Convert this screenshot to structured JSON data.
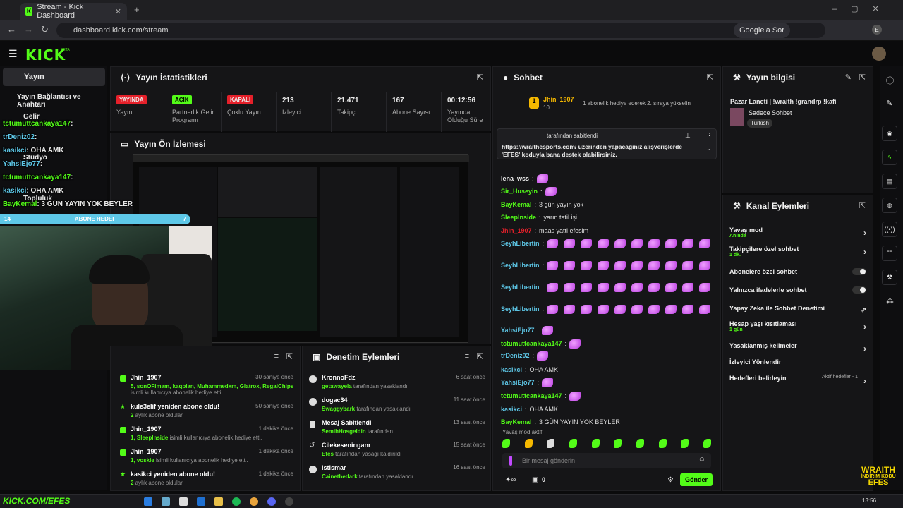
{
  "browser": {
    "tab_title": "Stream - Kick Dashboard",
    "url": "dashboard.kick.com/stream",
    "google_btn": "Google'a Sor",
    "profile_initial": "E"
  },
  "app": {
    "logo": "KICK",
    "beta": "BETA"
  },
  "sidebar": {
    "items": [
      {
        "label": "Yayın"
      },
      {
        "label": "Yayın Bağlantısı ve Anahtarı"
      },
      {
        "label": "Gelir"
      },
      {
        "label": "Stüdyo"
      },
      {
        "label": "Topluluk"
      }
    ]
  },
  "overlay_chat": [
    {
      "user": "tctumuttcankaya147",
      "text": ":"
    },
    {
      "user": "trDeniz02",
      "text": ":"
    },
    {
      "user": "kasikci",
      "text": ": OHA AMK"
    },
    {
      "user": "YahsiEjo77",
      "text": ":"
    },
    {
      "user": "tctumuttcankaya147",
      "text": ":"
    },
    {
      "user": "kasikci",
      "text": ": OHA AMK"
    },
    {
      "user": "BayKemal",
      "text": ": 3 GÜN YAYIN YOK BEYLER"
    }
  ],
  "abone_bar": {
    "left": "14",
    "label": "ABONE HEDEF",
    "right": "7"
  },
  "stats": {
    "title": "Yayın İstatistikleri",
    "items": [
      {
        "badge": "YAYINDA",
        "label": "Yayın",
        "color": "#e5202a"
      },
      {
        "badge": "AÇIK",
        "label": "Partnerlik Gelir Programı",
        "color": "#53fc18"
      },
      {
        "badge": "KAPALI",
        "label": "Çoklu Yayın",
        "color": "#e5202a"
      },
      {
        "value": "213",
        "label": "İzleyici"
      },
      {
        "value": "21.471",
        "label": "Takipçi"
      },
      {
        "value": "167",
        "label": "Abone Sayısı"
      },
      {
        "value": "00:12:56",
        "label": "Yayında Olduğu Süre"
      }
    ]
  },
  "preview": {
    "title": "Yayın Ön İzlemesi"
  },
  "activity": {
    "items": [
      {
        "title": "Jhin_1907",
        "time": "30 saniye önce",
        "sub_users": "5, sonOFimam, kaqplan, Muhammedxm, Glatrox, RegalChips",
        "sub_rest": " isimli kullanıcıya abonelik hediye etti."
      },
      {
        "title": "kule3elif yeniden abone oldu!",
        "time": "50 saniye önce",
        "sub_users": "2",
        "sub_rest": " aylık abone oldular"
      },
      {
        "title": "Jhin_1907",
        "time": "1 dakika önce",
        "sub_users": "1, SleepInside",
        "sub_rest": " isimli kullanıcıya abonelik hediye etti."
      },
      {
        "title": "Jhin_1907",
        "time": "1 dakika önce",
        "sub_users": "1, voskie",
        "sub_rest": " isimli kullanıcıya abonelik hediye etti."
      },
      {
        "title": "kasikci yeniden abone oldu!",
        "time": "1 dakika önce",
        "sub_users": "2",
        "sub_rest": " aylık abone oldular"
      }
    ]
  },
  "moderation": {
    "title": "Denetim Eylemleri",
    "items": [
      {
        "title": "KronnoFdz",
        "time": "6 saat önce",
        "user": "getawayela",
        "rest": " tarafından yasaklandı"
      },
      {
        "title": "dogac34",
        "time": "11 saat önce",
        "user": "Swaggybark",
        "rest": " tarafından yasaklandı"
      },
      {
        "title": "Mesaj Sabitlendi",
        "time": "13 saat önce",
        "user": "SemihHosgeldin",
        "rest": " tarafından"
      },
      {
        "title": "Cilekeseninganr",
        "time": "15 saat önce",
        "user": "Efes",
        "rest": " tarafından yasağı kaldırıldı"
      },
      {
        "title": "istismar",
        "time": "16 saat önce",
        "user": "Cainethedark",
        "rest": " tarafından yasaklandı"
      }
    ]
  },
  "chat": {
    "title": "Sohbet",
    "top_gifter": {
      "name": "Jhin_1907",
      "count": "10",
      "note": "1 abonelik hediye ederek 2. sıraya yükselin"
    },
    "pinned": {
      "by": "tarafından sabitlendi",
      "link": "https://wraithesports.com/",
      "text": " üzerinden yapacağınız alışverişlerde 'EFES' koduyla bana destek olabilirsiniz."
    },
    "messages": [
      {
        "user": "lena_wss",
        "text": "",
        "color": "#eeeeee",
        "emotes": 1
      },
      {
        "user": "Sir_Huseyin",
        "text": "",
        "color": "#53fc18",
        "emotes": 1
      },
      {
        "user": "BayKemal",
        "text": "3 gün yayın yok",
        "color": "#53fc18",
        "emotes": 0
      },
      {
        "user": "SleepInside",
        "text": "yarın tatil işi",
        "color": "#53fc18",
        "emotes": 0
      },
      {
        "user": "Jhin_1907",
        "text": "maas yatti efesim",
        "color": "#e5202a",
        "emotes": 0
      },
      {
        "user": "SeyhLibertin",
        "text": "",
        "color": "#5ec8e8",
        "emotes": 11
      },
      {
        "user": "SeyhLibertin",
        "text": "",
        "color": "#5ec8e8",
        "emotes": 11
      },
      {
        "user": "SeyhLibertin",
        "text": "",
        "color": "#5ec8e8",
        "emotes": 11
      },
      {
        "user": "SeyhLibertin",
        "text": "",
        "color": "#5ec8e8",
        "emotes": 11
      },
      {
        "user": "YahsiEjo77",
        "text": "",
        "color": "#5ec8e8",
        "emotes": 1
      },
      {
        "user": "tctumuttcankaya147",
        "text": "",
        "color": "#53fc18",
        "emotes": 1
      },
      {
        "user": "trDeniz02",
        "text": "",
        "color": "#5ec8e8",
        "emotes": 1
      },
      {
        "user": "kasikci",
        "text": "OHA AMK",
        "color": "#5ec8e8",
        "emotes": 0
      },
      {
        "user": "YahsiEjo77",
        "text": "",
        "color": "#5ec8e8",
        "emotes": 1
      },
      {
        "user": "tctumuttcankaya147",
        "text": "",
        "color": "#53fc18",
        "emotes": 1
      },
      {
        "user": "kasikci",
        "text": "OHA AMK",
        "color": "#5ec8e8",
        "emotes": 0
      },
      {
        "user": "BayKemal",
        "text": "3 GÜN YAYIN YOK BEYLER",
        "color": "#53fc18",
        "emotes": 0
      }
    ],
    "slow_mode": "Yavaş mod aktif",
    "input_placeholder": "Bir mesaj gönderin",
    "points": "0",
    "send": "Gönder"
  },
  "stream_info": {
    "title": "Yayın bilgisi",
    "stream_title": "Pazar Laneti | !wraith !grandrp !kafi",
    "category": "Sadece Sohbet",
    "tag": "Turkish"
  },
  "channel_actions": {
    "title": "Kanal Eylemleri",
    "items": [
      {
        "label": "Yavaş mod",
        "sub": "Anında",
        "control": "chevron"
      },
      {
        "label": "Takipçilere özel sohbet",
        "sub": "1 dk.",
        "control": "chevron"
      },
      {
        "label": "Abonelere özel sohbet",
        "sub": "",
        "control": "toggle"
      },
      {
        "label": "Yalnızca ifadelerle sohbet",
        "sub": "",
        "control": "toggle"
      },
      {
        "label": "Yapay Zeka ile Sohbet Denetimi",
        "sub": "",
        "control": "external"
      },
      {
        "label": "Hesap yaşı kısıtlaması",
        "sub": "1 gün",
        "control": "chevron"
      },
      {
        "label": "Yasaklanmış kelimeler",
        "sub": "",
        "control": "chevron"
      },
      {
        "label": "İzleyici Yönlendir",
        "sub": "",
        "control": "none"
      },
      {
        "label": "Hedefleri belirleyin",
        "sub": "",
        "control": "chevron",
        "note": "Aktif hedefler - 1"
      }
    ]
  },
  "overlay_logo": {
    "line1": "WRAITH",
    "line2": "İNDİRİM KODU",
    "line3": "EFES"
  },
  "taskbar": {
    "left_text": "KICK.COM/EFES",
    "time": "13:56"
  }
}
